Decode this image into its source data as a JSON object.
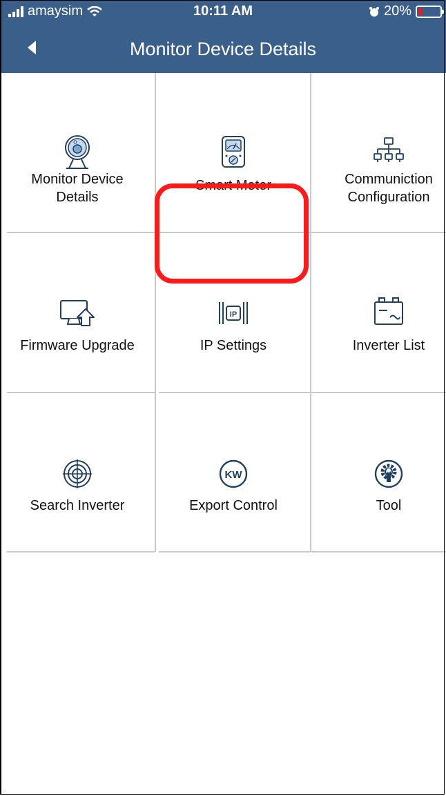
{
  "status_bar": {
    "carrier": "amaysim",
    "time": "10:11 AM",
    "battery_text": "20%",
    "icons": [
      "signal-icon",
      "wifi-icon",
      "alarm-icon",
      "battery-icon"
    ]
  },
  "nav": {
    "title": "Monitor Device Details",
    "back_icon": "back-arrow-icon"
  },
  "grid": {
    "items": [
      {
        "label_line1": "Monitor Device",
        "label_line2": "Details",
        "icon": "webcam-icon"
      },
      {
        "label_line1": "Smart Meter",
        "label_line2": "",
        "icon": "meter-icon"
      },
      {
        "label_line1": "Communiction",
        "label_line2": "Configuration",
        "icon": "network-icon"
      },
      {
        "label_line1": "Firmware Upgrade",
        "label_line2": "",
        "icon": "upload-monitor-icon"
      },
      {
        "label_line1": "IP Settings",
        "label_line2": "",
        "icon": "ip-icon"
      },
      {
        "label_line1": "Inverter List",
        "label_line2": "",
        "icon": "battery-inverter-icon"
      },
      {
        "label_line1": "Search Inverter",
        "label_line2": "",
        "icon": "target-icon"
      },
      {
        "label_line1": "Export Control",
        "label_line2": "",
        "icon": "kw-icon"
      },
      {
        "label_line1": "Tool",
        "label_line2": "",
        "icon": "gear-wrench-icon"
      }
    ]
  },
  "colors": {
    "header_bg": "#3a5f8a",
    "icon_color": "#1f3f63",
    "highlight": "#ff1a1a",
    "grid_line": "#c9c9c9"
  }
}
